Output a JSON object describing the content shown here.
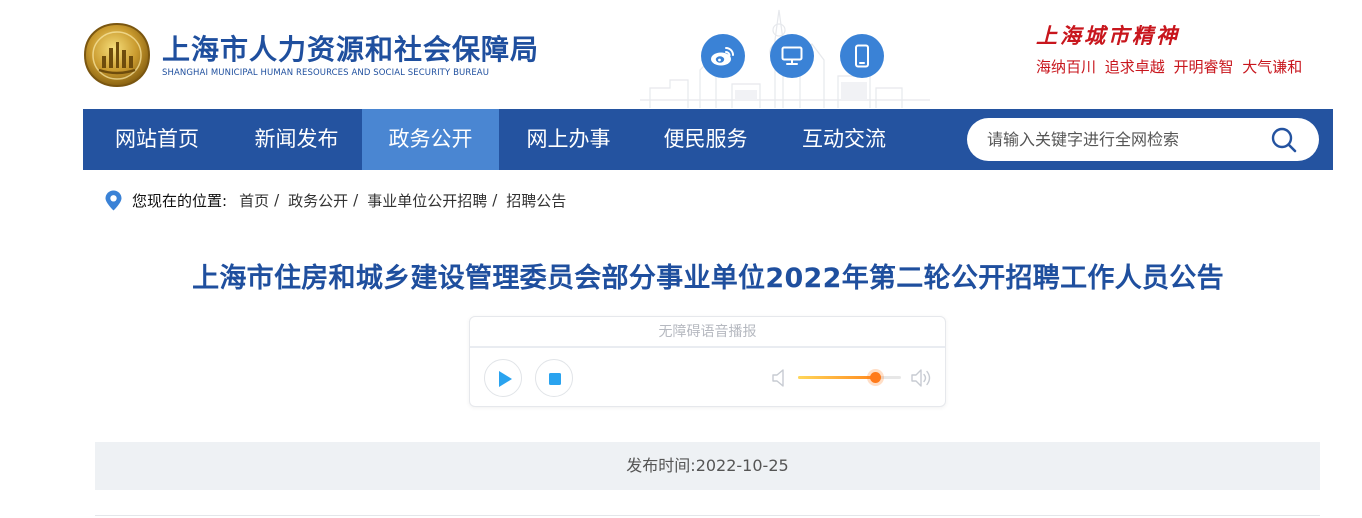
{
  "header": {
    "site_name": "上海市人力资源和社会保障局",
    "site_name_en": "SHANGHAI MUNICIPAL HUMAN RESOURCES AND SOCIAL SECURITY BUREAU",
    "icons": [
      "weibo-icon",
      "desktop-icon",
      "mobile-icon"
    ],
    "spirit_title": "上海城市精神",
    "spirit_motto": "海纳百川 追求卓越 开明睿智 大气谦和"
  },
  "nav": {
    "items": [
      {
        "label": "网站首页"
      },
      {
        "label": "新闻发布"
      },
      {
        "label": "政务公开",
        "active": true
      },
      {
        "label": "网上办事"
      },
      {
        "label": "便民服务"
      },
      {
        "label": "互动交流"
      }
    ],
    "search_placeholder": "请输入关键字进行全网检索"
  },
  "breadcrumb": {
    "label": "您现在的位置:",
    "items": [
      "首页",
      "政务公开",
      "事业单位公开招聘",
      "招聘公告"
    ],
    "separator": "/"
  },
  "article": {
    "title": "上海市住房和城乡建设管理委员会部分事业单位2022年第二轮公开招聘工作人员公告",
    "player": {
      "header": "无障碍语音播报",
      "volume": 0.75
    },
    "publish_time": "发布时间:2022-10-25"
  },
  "colors": {
    "brand_blue": "#2453a0",
    "nav_active": "#4a86d2",
    "title_blue": "#1f4f9e",
    "spirit_red": "#c8161d",
    "icon_circle": "#3a82d6"
  }
}
